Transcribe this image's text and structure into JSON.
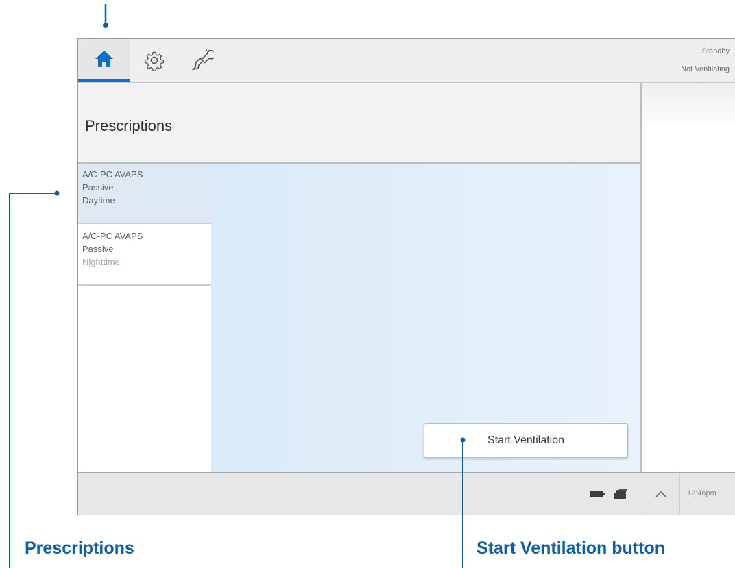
{
  "colors": {
    "accent": "#0b6fd1",
    "annotation": "#0b5eac",
    "selected_item_bg": "#dfe9f5"
  },
  "topbar": {
    "tabs": [
      {
        "icon": "home-icon",
        "selected": true
      },
      {
        "icon": "gear-icon",
        "selected": false
      },
      {
        "icon": "tools-icon",
        "selected": false
      }
    ],
    "status": {
      "mode": "Standby",
      "ventilation": "Not Ventilating"
    }
  },
  "main": {
    "title": "Prescriptions",
    "prescriptions": [
      {
        "mode": "A/C-PC AVAPS",
        "type": "Passive",
        "name": "Daytime",
        "selected": true
      },
      {
        "mode": "A/C-PC AVAPS",
        "type": "Passive",
        "name": "Nighttime",
        "selected": false
      }
    ],
    "start_button_label": "Start Ventilation"
  },
  "bottombar": {
    "icons": [
      "battery-icon",
      "external-power-icon",
      "chevron-up-icon"
    ],
    "time": "12:46pm"
  },
  "annotations": {
    "prescriptions_label": "Prescriptions",
    "start_button_label": "Start Ventilation button"
  }
}
